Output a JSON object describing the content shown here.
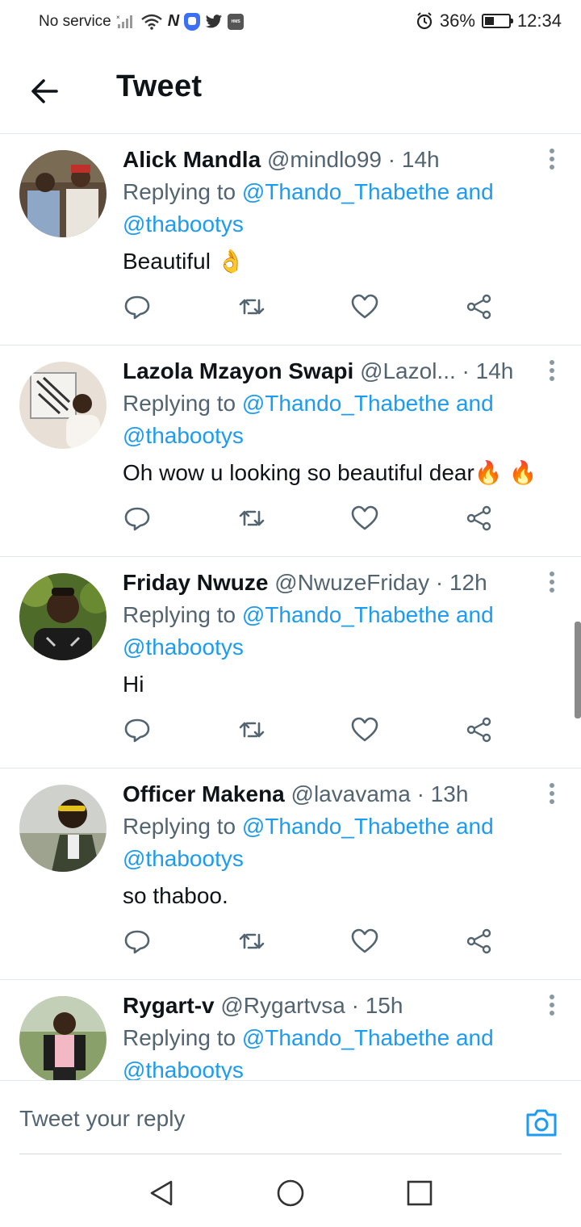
{
  "status_bar": {
    "carrier": "No service",
    "battery": "36%",
    "time": "12:34"
  },
  "header": {
    "title": "Tweet"
  },
  "tweets": [
    {
      "name": "Alick Mandla",
      "handle": "@mindlo99",
      "time": "· 14h",
      "replying_prefix": "Replying to",
      "mention1": "@Thando_Thabethe",
      "and": "and",
      "mention2": "@thabootys",
      "text": "Beautiful 👌"
    },
    {
      "name": "Lazola Mzayon Swapi",
      "handle": "@Lazol...",
      "time": "· 14h",
      "replying_prefix": "Replying to",
      "mention1": "@Thando_Thabethe",
      "and": "and",
      "mention2": "@thabootys",
      "text": "Oh wow u looking so beautiful dear🔥 🔥"
    },
    {
      "name": "Friday Nwuze",
      "handle": "@NwuzeFriday",
      "time": "· 12h",
      "replying_prefix": "Replying to",
      "mention1": "@Thando_Thabethe",
      "and": "and",
      "mention2": "@thabootys",
      "text": "Hi"
    },
    {
      "name": "Officer Makena",
      "handle": "@lavavama",
      "time": "· 13h",
      "replying_prefix": "Replying to",
      "mention1": "@Thando_Thabethe",
      "and": "and",
      "mention2": "@thabootys",
      "text": "so thaboo."
    },
    {
      "name": "Rygart-v",
      "handle": "@Rygartvsa",
      "time": "· 15h",
      "replying_prefix": "Replying to",
      "mention1": "@Thando_Thabethe",
      "and": "and",
      "mention2": "@thabootys",
      "text": ""
    }
  ],
  "reply": {
    "placeholder": "Tweet your reply"
  },
  "colors": {
    "link": "#1d9bf0",
    "muted": "#536471"
  }
}
